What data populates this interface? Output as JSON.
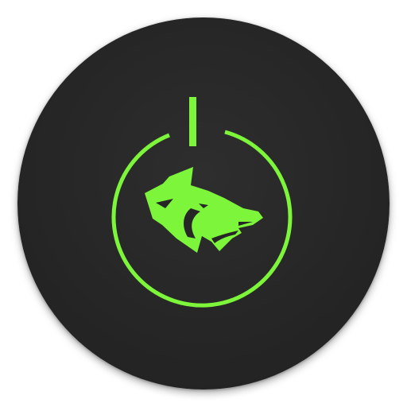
{
  "app_icon": {
    "icon_name": "power-wolf-icon",
    "background_color": "#262626",
    "accent_color": "#7cf53a"
  }
}
